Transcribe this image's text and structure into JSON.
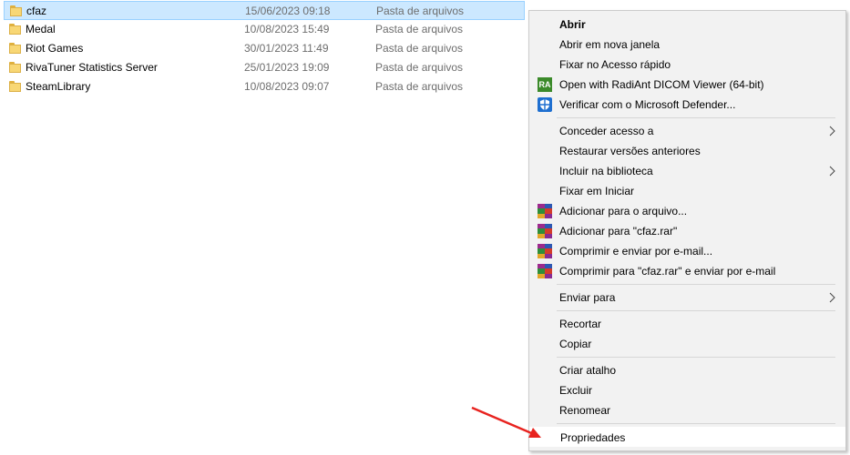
{
  "files": [
    {
      "name": "cfaz",
      "date": "15/06/2023 09:18",
      "type": "Pasta de arquivos",
      "selected": true
    },
    {
      "name": "Medal",
      "date": "10/08/2023 15:49",
      "type": "Pasta de arquivos"
    },
    {
      "name": "Riot Games",
      "date": "30/01/2023 11:49",
      "type": "Pasta de arquivos"
    },
    {
      "name": "RivaTuner Statistics Server",
      "date": "25/01/2023 19:09",
      "type": "Pasta de arquivos"
    },
    {
      "name": "SteamLibrary",
      "date": "10/08/2023 09:07",
      "type": "Pasta de arquivos"
    }
  ],
  "menu": {
    "abrir": "Abrir",
    "abrir_nova_janela": "Abrir em nova janela",
    "fixar_acesso_rapido": "Fixar no Acesso rápido",
    "radiant": "Open with RadiAnt DICOM Viewer (64-bit)",
    "radiant_icon_text": "RA",
    "defender": "Verificar com o Microsoft Defender...",
    "conceder_acesso": "Conceder acesso a",
    "restaurar_versoes": "Restaurar versões anteriores",
    "incluir_biblioteca": "Incluir na biblioteca",
    "fixar_iniciar": "Fixar em Iniciar",
    "adicionar_arquivo": "Adicionar para o arquivo...",
    "adicionar_cfaz": "Adicionar para \"cfaz.rar\"",
    "comprimir_email": "Comprimir e enviar por e-mail...",
    "comprimir_cfaz_email": "Comprimir para \"cfaz.rar\" e enviar por e-mail",
    "enviar_para": "Enviar para",
    "recortar": "Recortar",
    "copiar": "Copiar",
    "criar_atalho": "Criar atalho",
    "excluir": "Excluir",
    "renomear": "Renomear",
    "propriedades": "Propriedades"
  },
  "colors": {
    "selection": "#cce8ff",
    "menu_bg": "#f2f2f2",
    "arrow": "#e8231f"
  }
}
